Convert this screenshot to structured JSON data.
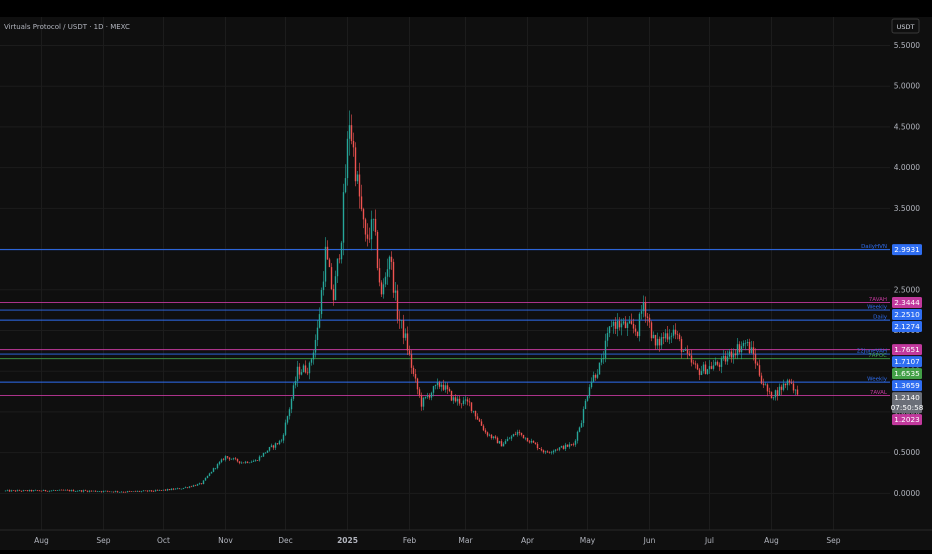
{
  "chart_data": {
    "type": "candlestick",
    "title": "Virtuals Protocol / USDT · 1D · MEXC",
    "currency": "USDT",
    "ylim": [
      -0.45,
      5.85
    ],
    "y_ticks": [
      0.0,
      0.5,
      1.0,
      1.5,
      2.0,
      2.5,
      3.0,
      3.5,
      4.0,
      4.5,
      5.0,
      5.5
    ],
    "x_ticks": [
      {
        "label": "Aug",
        "day": 18
      },
      {
        "label": "Sep",
        "day": 49
      },
      {
        "label": "Oct",
        "day": 79
      },
      {
        "label": "Nov",
        "day": 110
      },
      {
        "label": "Dec",
        "day": 140
      },
      {
        "label": "2025",
        "day": 171,
        "bold": true
      },
      {
        "label": "Feb",
        "day": 202
      },
      {
        "label": "Mar",
        "day": 230
      },
      {
        "label": "Apr",
        "day": 261
      },
      {
        "label": "May",
        "day": 291
      },
      {
        "label": "Jun",
        "day": 322
      },
      {
        "label": "Jul",
        "day": 352
      },
      {
        "label": "Aug",
        "day": 383
      },
      {
        "label": "Sep",
        "day": 414
      }
    ],
    "price_levels": [
      {
        "label": "DailyHVN",
        "price": 2.9931,
        "color": "#2f6ef2",
        "badge": "2.9931"
      },
      {
        "label": "7AVAH",
        "price": 2.3444,
        "color": "#c2399d",
        "badge": "2.3444"
      },
      {
        "label": "Weekly",
        "price": 2.251,
        "color": "#2f6ef2",
        "badge": "2.2510"
      },
      {
        "label": "Daily",
        "price": 2.1274,
        "color": "#2f6ef2",
        "badge": "2.1274"
      },
      {
        "label": "",
        "price": 1.7651,
        "color": "#c2399d",
        "badge": "1.7651"
      },
      {
        "label": "22JuneVAH",
        "price": 1.7107,
        "color": "#2f6ef2",
        "badge": "1.7107"
      },
      {
        "label": "7APOC",
        "price": 1.6535,
        "color": "#43a047",
        "badge": "1.6535"
      },
      {
        "label": "Weekly",
        "price": 1.3659,
        "color": "#2f6ef2",
        "badge": "1.3659"
      },
      {
        "label": "7AVAL",
        "price": 1.2023,
        "color": "#c2399d",
        "badge": "1.2023"
      }
    ],
    "current_price": {
      "price": 1.214,
      "label": "1.2140",
      "countdown": "07:50:58"
    },
    "price_path": [
      {
        "day": 0,
        "price": 0.03
      },
      {
        "day": 30,
        "price": 0.035
      },
      {
        "day": 60,
        "price": 0.02
      },
      {
        "day": 75,
        "price": 0.03
      },
      {
        "day": 88,
        "price": 0.06
      },
      {
        "day": 98,
        "price": 0.12
      },
      {
        "day": 104,
        "price": 0.3
      },
      {
        "day": 110,
        "price": 0.45
      },
      {
        "day": 118,
        "price": 0.38
      },
      {
        "day": 125,
        "price": 0.4
      },
      {
        "day": 132,
        "price": 0.55
      },
      {
        "day": 138,
        "price": 0.65
      },
      {
        "day": 142,
        "price": 1.05
      },
      {
        "day": 146,
        "price": 1.5
      },
      {
        "day": 152,
        "price": 1.55
      },
      {
        "day": 156,
        "price": 2.0
      },
      {
        "day": 160,
        "price": 2.95
      },
      {
        "day": 164,
        "price": 2.4
      },
      {
        "day": 168,
        "price": 3.2
      },
      {
        "day": 172,
        "price": 4.6
      },
      {
        "day": 176,
        "price": 3.8
      },
      {
        "day": 180,
        "price": 3.1
      },
      {
        "day": 184,
        "price": 3.3
      },
      {
        "day": 188,
        "price": 2.4
      },
      {
        "day": 192,
        "price": 2.95
      },
      {
        "day": 196,
        "price": 2.2
      },
      {
        "day": 200,
        "price": 1.9
      },
      {
        "day": 204,
        "price": 1.45
      },
      {
        "day": 208,
        "price": 1.1
      },
      {
        "day": 213,
        "price": 1.25
      },
      {
        "day": 218,
        "price": 1.35
      },
      {
        "day": 224,
        "price": 1.15
      },
      {
        "day": 232,
        "price": 1.1
      },
      {
        "day": 240,
        "price": 0.75
      },
      {
        "day": 248,
        "price": 0.6
      },
      {
        "day": 256,
        "price": 0.75
      },
      {
        "day": 262,
        "price": 0.65
      },
      {
        "day": 270,
        "price": 0.5
      },
      {
        "day": 276,
        "price": 0.55
      },
      {
        "day": 284,
        "price": 0.6
      },
      {
        "day": 288,
        "price": 0.9
      },
      {
        "day": 292,
        "price": 1.35
      },
      {
        "day": 298,
        "price": 1.6
      },
      {
        "day": 303,
        "price": 2.1
      },
      {
        "day": 310,
        "price": 2.05
      },
      {
        "day": 316,
        "price": 2.0
      },
      {
        "day": 319,
        "price": 2.35
      },
      {
        "day": 325,
        "price": 1.8
      },
      {
        "day": 330,
        "price": 1.95
      },
      {
        "day": 334,
        "price": 2.0
      },
      {
        "day": 340,
        "price": 1.7
      },
      {
        "day": 346,
        "price": 1.5
      },
      {
        "day": 352,
        "price": 1.55
      },
      {
        "day": 358,
        "price": 1.6
      },
      {
        "day": 364,
        "price": 1.75
      },
      {
        "day": 370,
        "price": 1.85
      },
      {
        "day": 374,
        "price": 1.7
      },
      {
        "day": 378,
        "price": 1.4
      },
      {
        "day": 382,
        "price": 1.2
      },
      {
        "day": 386,
        "price": 1.25
      },
      {
        "day": 392,
        "price": 1.4
      },
      {
        "day": 396,
        "price": 1.21
      }
    ]
  }
}
